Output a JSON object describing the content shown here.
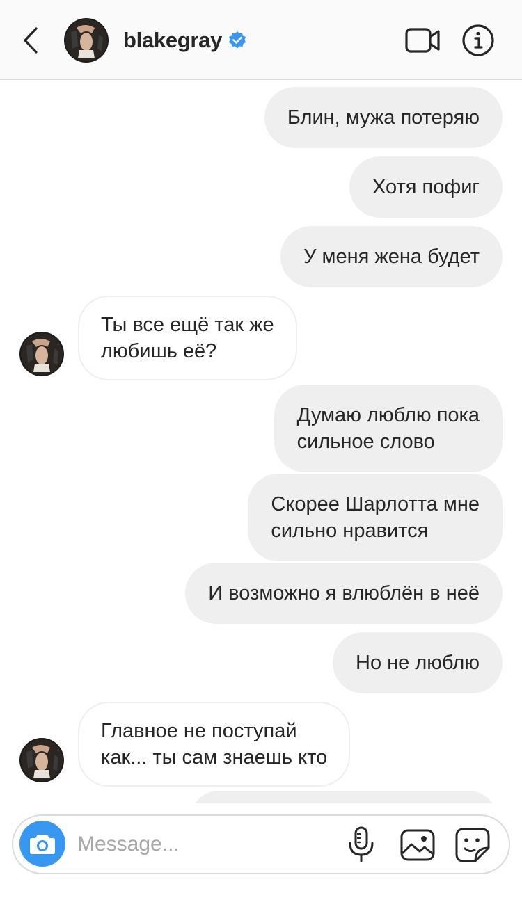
{
  "header": {
    "username": "blakegray",
    "verified": true,
    "accent_color": "#3897f0"
  },
  "icons": {
    "back": "chevron-left-icon",
    "video": "video-camera-icon",
    "info": "info-icon",
    "verified": "verified-badge-icon",
    "camera": "camera-icon",
    "mic": "microphone-icon",
    "gallery": "image-icon",
    "sticker": "sticker-icon"
  },
  "messages": [
    {
      "side": "out",
      "lines": [
        "Блин, мужа потеряю"
      ]
    },
    {
      "side": "out",
      "lines": [
        "Хотя пофиг"
      ]
    },
    {
      "side": "out",
      "lines": [
        "У меня жена будет"
      ]
    },
    {
      "side": "in",
      "lines": [
        "Ты все ещё так же",
        "любишь её?"
      ]
    },
    {
      "side": "out",
      "lines": [
        "Думаю люблю пока",
        "сильное слово"
      ]
    },
    {
      "side": "out",
      "lines": [
        "Скорее Шарлотта мне",
        "сильно нравится"
      ]
    },
    {
      "side": "out",
      "lines": [
        "И возможно я влюблён в неё"
      ]
    },
    {
      "side": "out",
      "lines": [
        "Но не люблю"
      ]
    },
    {
      "side": "in",
      "lines": [
        "Главное не поступай",
        "как... ты сам знаешь кто"
      ]
    }
  ],
  "composer": {
    "placeholder": "Message..."
  }
}
